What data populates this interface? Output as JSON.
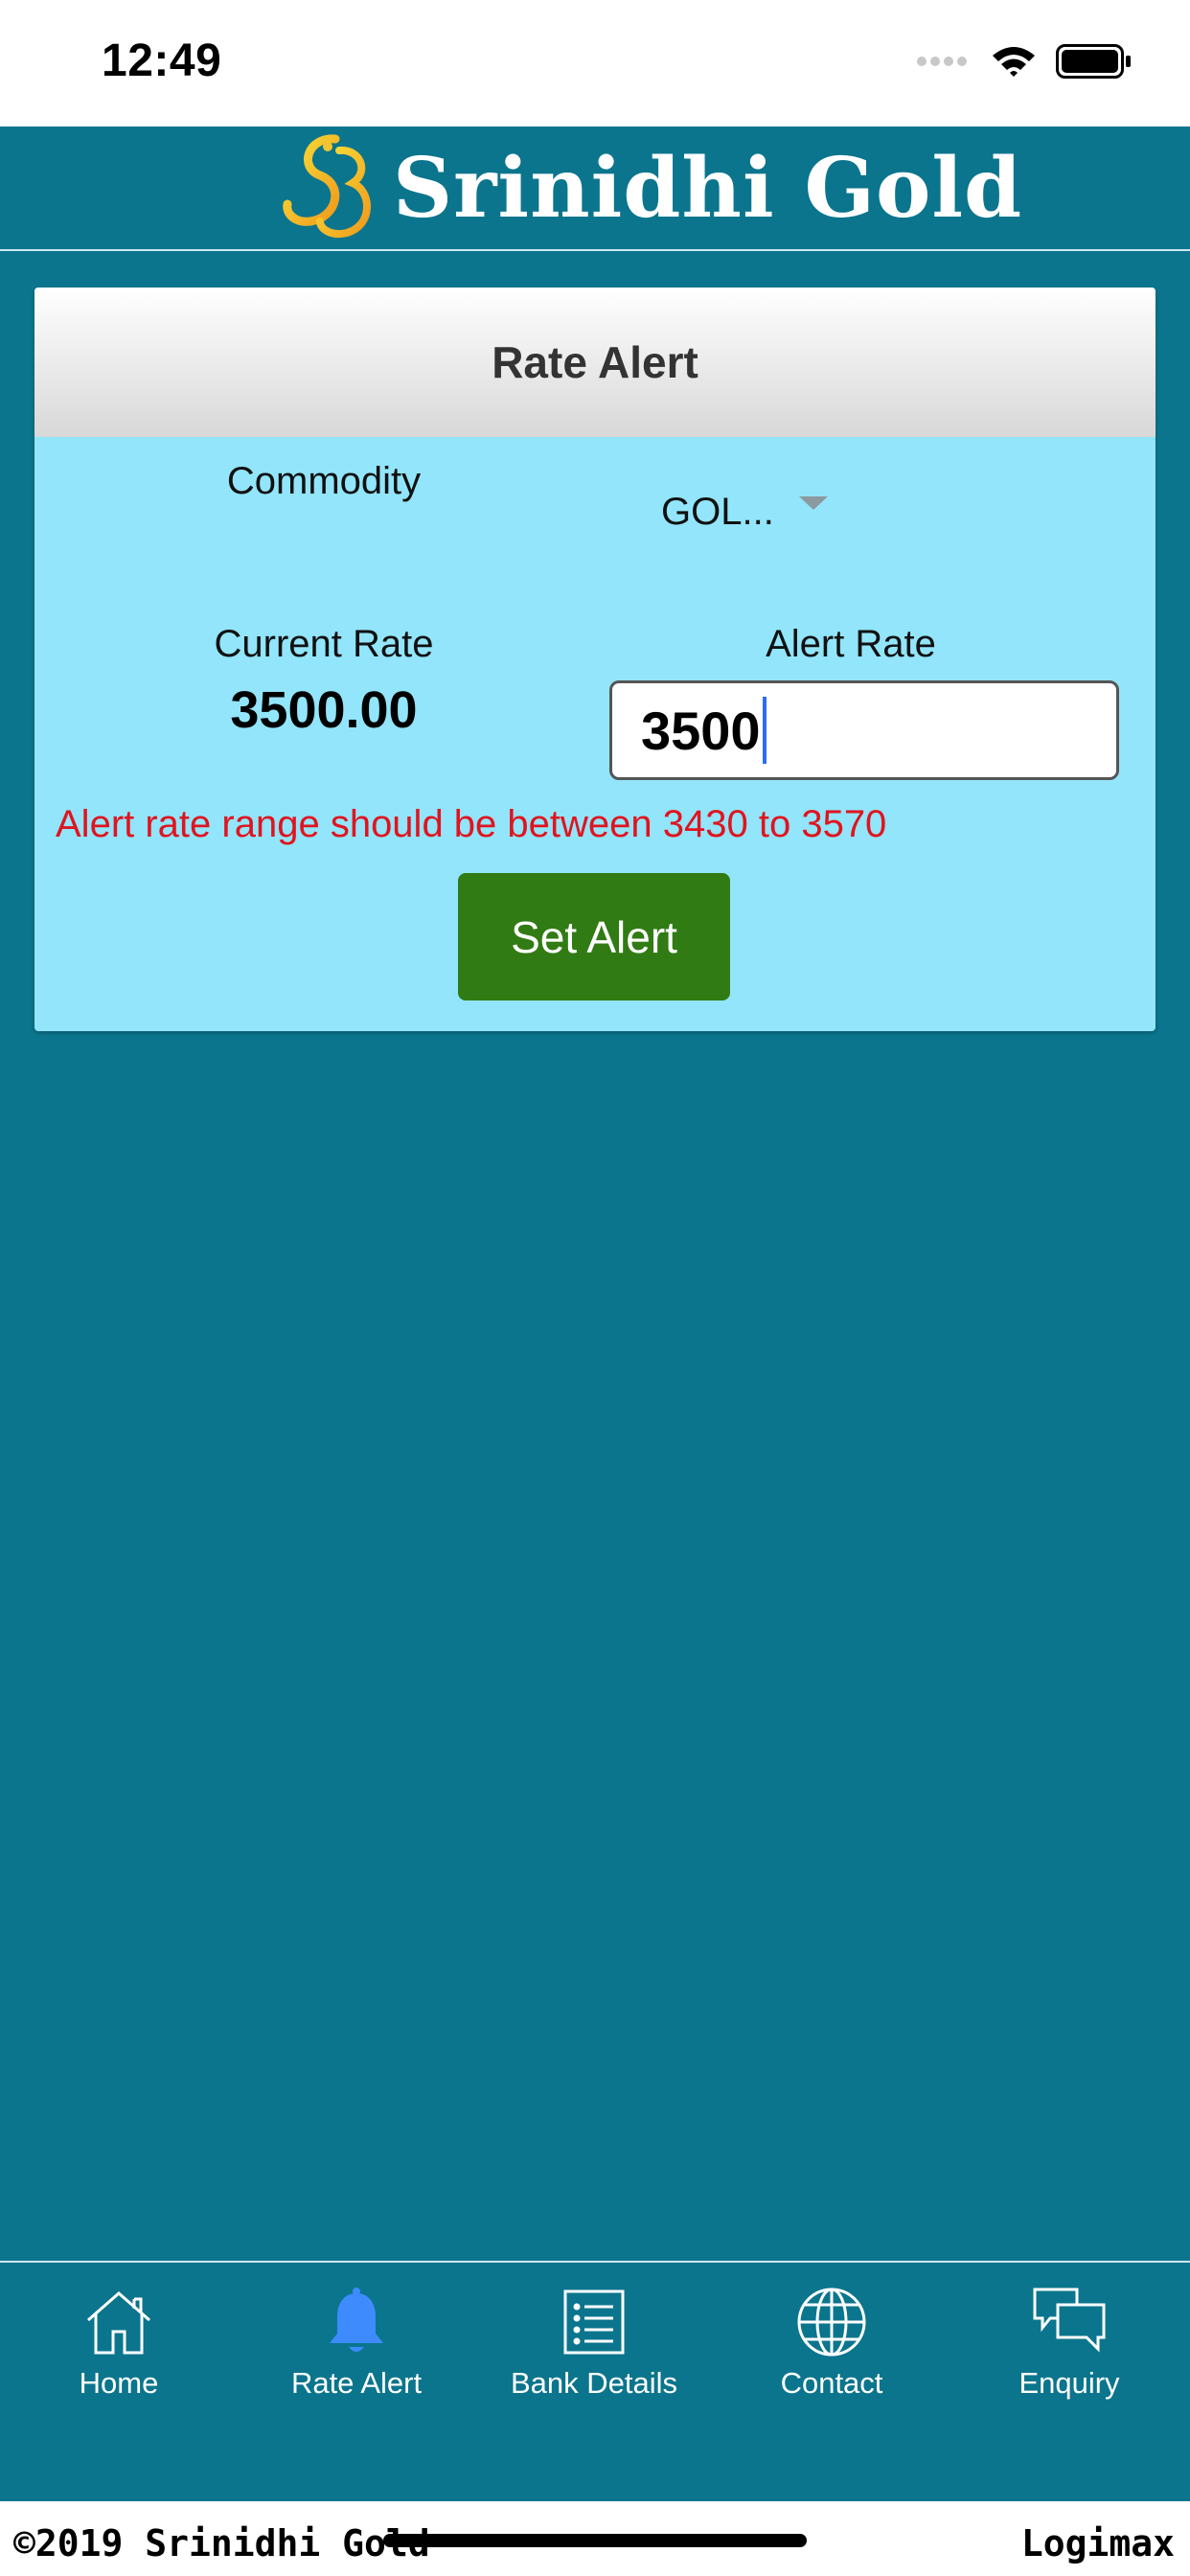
{
  "status_bar": {
    "time": "12:49"
  },
  "header": {
    "brand": "Srinidhi Gold"
  },
  "card": {
    "title": "Rate Alert",
    "commodity_label": "Commodity",
    "commodity_value": "GOL...",
    "current_rate_label": "Current Rate",
    "current_rate_value": "3500.00",
    "alert_rate_label": "Alert Rate",
    "alert_rate_value": "3500",
    "error_message": "Alert rate range should be between 3430 to 3570",
    "set_alert_label": "Set Alert"
  },
  "nav": {
    "items": [
      {
        "label": "Home",
        "icon": "home-icon"
      },
      {
        "label": "Rate Alert",
        "icon": "bell-icon",
        "active": true
      },
      {
        "label": "Bank Details",
        "icon": "list-icon"
      },
      {
        "label": "Contact",
        "icon": "globe-icon"
      },
      {
        "label": "Enquiry",
        "icon": "chat-icon"
      }
    ]
  },
  "footer": {
    "copyright": "©2019 Srinidhi Gold",
    "vendor": "Logimax"
  },
  "colors": {
    "background": "#0b758d",
    "card": "#92e5fb",
    "button": "#317b14",
    "error": "#e0141e",
    "active_icon": "#3d8bfd"
  }
}
